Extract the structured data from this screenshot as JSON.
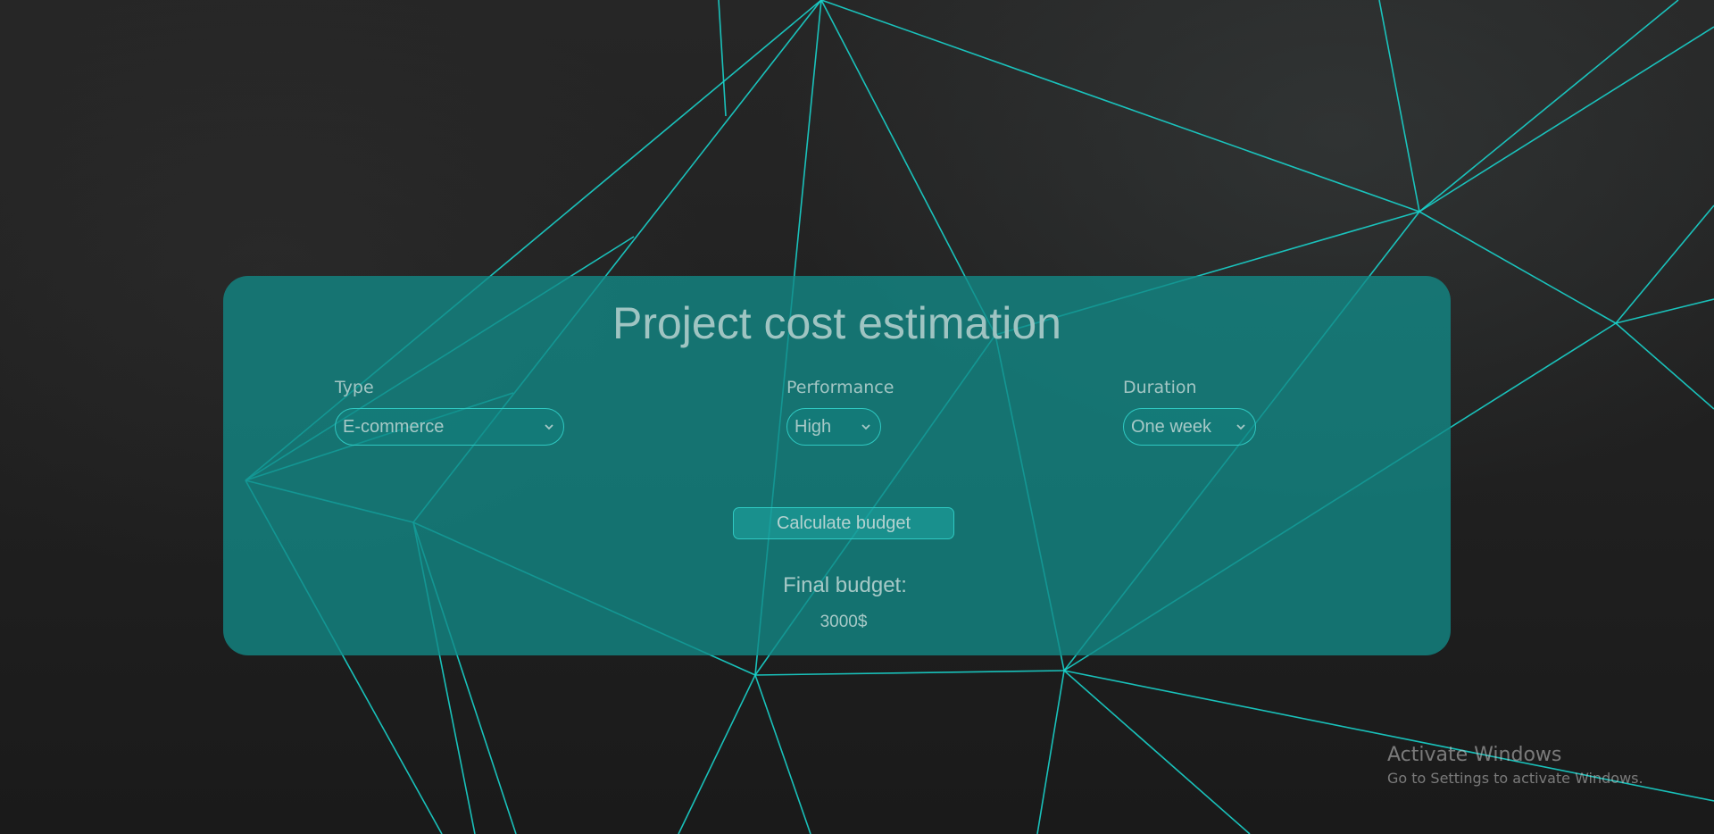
{
  "app": {
    "title": "Project cost estimation"
  },
  "form": {
    "type": {
      "label": "Type",
      "value": "E-commerce"
    },
    "performance": {
      "label": "Performance",
      "value": "High"
    },
    "duration": {
      "label": "Duration",
      "value": "One week"
    },
    "calculate_label": "Calculate budget"
  },
  "result": {
    "label": "Final budget:",
    "value": "3000$"
  },
  "watermark": {
    "title": "Activate Windows",
    "subtitle": "Go to Settings to activate Windows."
  },
  "colors": {
    "accent": "#19d3cc",
    "panel": "#128b88",
    "background": "#1f1f1f",
    "text": "#a7c9c7"
  },
  "icons": {
    "select_chevron": "chevron-down-icon",
    "background_mesh": "polygon-mesh"
  }
}
